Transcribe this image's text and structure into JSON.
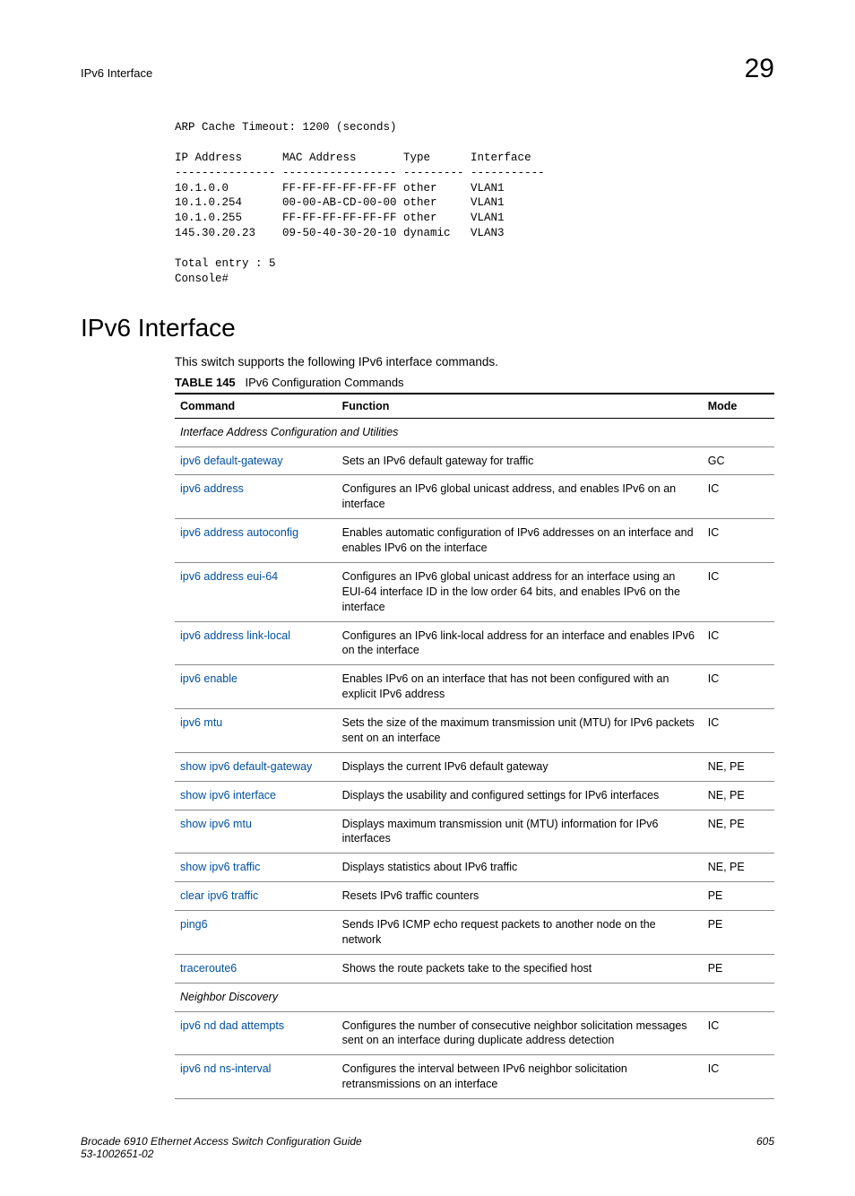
{
  "header": {
    "left": "IPv6 Interface",
    "right": "29"
  },
  "code": "ARP Cache Timeout: 1200 (seconds)\n\nIP Address      MAC Address       Type      Interface\n--------------- ----------------- --------- -----------\n10.1.0.0        FF-FF-FF-FF-FF-FF other     VLAN1\n10.1.0.254      00-00-AB-CD-00-00 other     VLAN1\n10.1.0.255      FF-FF-FF-FF-FF-FF other     VLAN1\n145.30.20.23    09-50-40-30-20-10 dynamic   VLAN3\n\nTotal entry : 5\nConsole#",
  "section_title": "IPv6 Interface",
  "intro": "This switch supports the following IPv6 interface commands.",
  "table": {
    "label": "TABLE 145",
    "caption": "IPv6 Configuration Commands",
    "head": {
      "command": "Command",
      "function": "Function",
      "mode": "Mode"
    },
    "rows": [
      {
        "type": "section",
        "text": "Interface Address Configuration and Utilities"
      },
      {
        "type": "row",
        "cmd": "ipv6 default-gateway",
        "func": "Sets an IPv6 default gateway for traffic",
        "mode": "GC"
      },
      {
        "type": "row",
        "cmd": "ipv6 address",
        "func": "Configures an IPv6 global unicast address, and enables IPv6 on an interface",
        "mode": "IC"
      },
      {
        "type": "row",
        "cmd": "ipv6 address autoconfig",
        "func": "Enables automatic configuration of IPv6 addresses on an interface and enables IPv6 on the interface",
        "mode": "IC"
      },
      {
        "type": "row",
        "cmd": "ipv6 address eui-64",
        "func": "Configures an IPv6 global unicast address for an interface using an EUI-64 interface ID in the low order 64 bits, and enables IPv6 on the interface",
        "mode": "IC"
      },
      {
        "type": "row",
        "cmd": "ipv6 address link-local",
        "func": "Configures an IPv6 link-local address for an interface and enables IPv6 on the interface",
        "mode": "IC"
      },
      {
        "type": "row",
        "cmd": "ipv6 enable",
        "func": "Enables IPv6 on an interface that has not been configured with an explicit IPv6 address",
        "mode": "IC"
      },
      {
        "type": "row",
        "cmd": "ipv6 mtu",
        "func": "Sets the size of the maximum transmission unit (MTU) for IPv6 packets sent on an interface",
        "mode": "IC"
      },
      {
        "type": "row",
        "cmd": "show ipv6 default-gateway",
        "func": "Displays the current IPv6 default gateway",
        "mode": "NE, PE"
      },
      {
        "type": "row",
        "cmd": "show ipv6 interface",
        "func": "Displays the usability and configured settings for IPv6 interfaces",
        "mode": "NE, PE"
      },
      {
        "type": "row",
        "cmd": "show ipv6 mtu",
        "func": "Displays maximum transmission unit (MTU) information for IPv6 interfaces",
        "mode": "NE, PE"
      },
      {
        "type": "row",
        "cmd": "show ipv6 traffic",
        "func": "Displays statistics about IPv6 traffic",
        "mode": "NE, PE"
      },
      {
        "type": "row",
        "cmd": "clear ipv6 traffic",
        "func": "Resets IPv6 traffic counters",
        "mode": "PE"
      },
      {
        "type": "row",
        "cmd": "ping6",
        "func": "Sends IPv6 ICMP echo request packets to another node on the network",
        "mode": "PE"
      },
      {
        "type": "row",
        "cmd": "traceroute6",
        "func": "Shows the route packets take to the specified host",
        "mode": "PE"
      },
      {
        "type": "section",
        "text": "Neighbor Discovery"
      },
      {
        "type": "row",
        "cmd": "ipv6 nd dad attempts",
        "func": "Configures the number of consecutive neighbor solicitation messages sent on an interface during duplicate address detection",
        "mode": "IC"
      },
      {
        "type": "row",
        "cmd": "ipv6 nd ns-interval",
        "func": "Configures the interval between IPv6 neighbor solicitation retransmissions on an interface",
        "mode": "IC"
      }
    ]
  },
  "footer": {
    "line1": "Brocade 6910 Ethernet Access Switch Configuration Guide",
    "line2": "53-1002651-02",
    "page": "605"
  }
}
